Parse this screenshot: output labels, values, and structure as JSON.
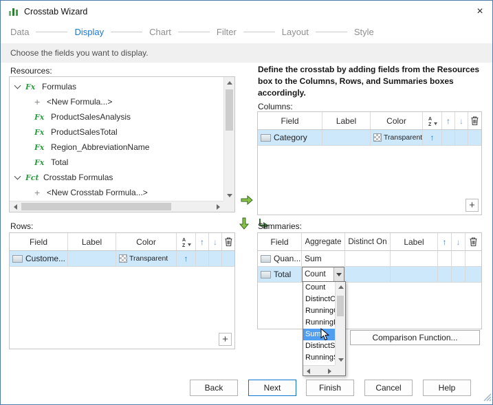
{
  "window": {
    "title": "Crosstab Wizard",
    "close_glyph": "×"
  },
  "steps": {
    "items": [
      {
        "label": "Data"
      },
      {
        "label": "Display"
      },
      {
        "label": "Chart"
      },
      {
        "label": "Filter"
      },
      {
        "label": "Layout"
      },
      {
        "label": "Style"
      }
    ],
    "active": "Display"
  },
  "subtitle": "Choose the fields you want to display.",
  "resources": {
    "label": "Resources:",
    "icons": {
      "formula": "Fx",
      "crosstab_formula": "Fct",
      "new_item": "+"
    },
    "items": [
      {
        "label": "Formulas"
      },
      {
        "label": "<New Formula...>"
      },
      {
        "label": "ProductSalesAnalysis"
      },
      {
        "label": "ProductSalesTotal"
      },
      {
        "label": "Region_AbbreviationName"
      },
      {
        "label": "Total"
      },
      {
        "label": "Crosstab Formulas"
      },
      {
        "label": "<New Crosstab Formula...>"
      }
    ]
  },
  "instructions": "Define the crosstab by adding fields from the Resources box to the Columns, Rows, and Summaries boxes accordingly.",
  "columns": {
    "label": "Columns:",
    "headers": [
      "Field",
      "Label",
      "Color"
    ],
    "rows": [
      {
        "field": "Category",
        "label": "",
        "color": "Transparent",
        "sort": "↑"
      }
    ],
    "add": "+"
  },
  "rows_box": {
    "label": "Rows:",
    "headers": [
      "Field",
      "Label",
      "Color"
    ],
    "rows": [
      {
        "field": "Custome...",
        "label": "",
        "color": "Transparent",
        "sort": "↑"
      }
    ],
    "add": "+"
  },
  "summaries": {
    "label": "Summaries:",
    "headers": [
      "Field",
      "Aggregate",
      "Distinct On",
      "Label"
    ],
    "rows": [
      {
        "field": "Quan...",
        "aggregate": "Sum",
        "distinct_on": "",
        "label": ""
      },
      {
        "field": "Total",
        "aggregate": "Count",
        "distinct_on": "",
        "label": ""
      }
    ]
  },
  "aggregate_dropdown": {
    "items": [
      "Count",
      "DistinctCount",
      "RunningCount",
      "RunningDistinctCount",
      "Sum",
      "DistinctSum",
      "RunningSum"
    ],
    "selected": "Sum"
  },
  "comparison_button_label": "Comparison Function...",
  "footer": {
    "buttons": [
      {
        "label": "Back"
      },
      {
        "label": "Next"
      },
      {
        "label": "Finish"
      },
      {
        "label": "Cancel"
      },
      {
        "label": "Help"
      }
    ],
    "default": "Next"
  },
  "colors": {
    "accent_blue": "#1b76d1",
    "selection_blue": "#cde8fb",
    "dropdown_highlight": "#4f9ef0",
    "arrow_green": "#8bc34a"
  }
}
